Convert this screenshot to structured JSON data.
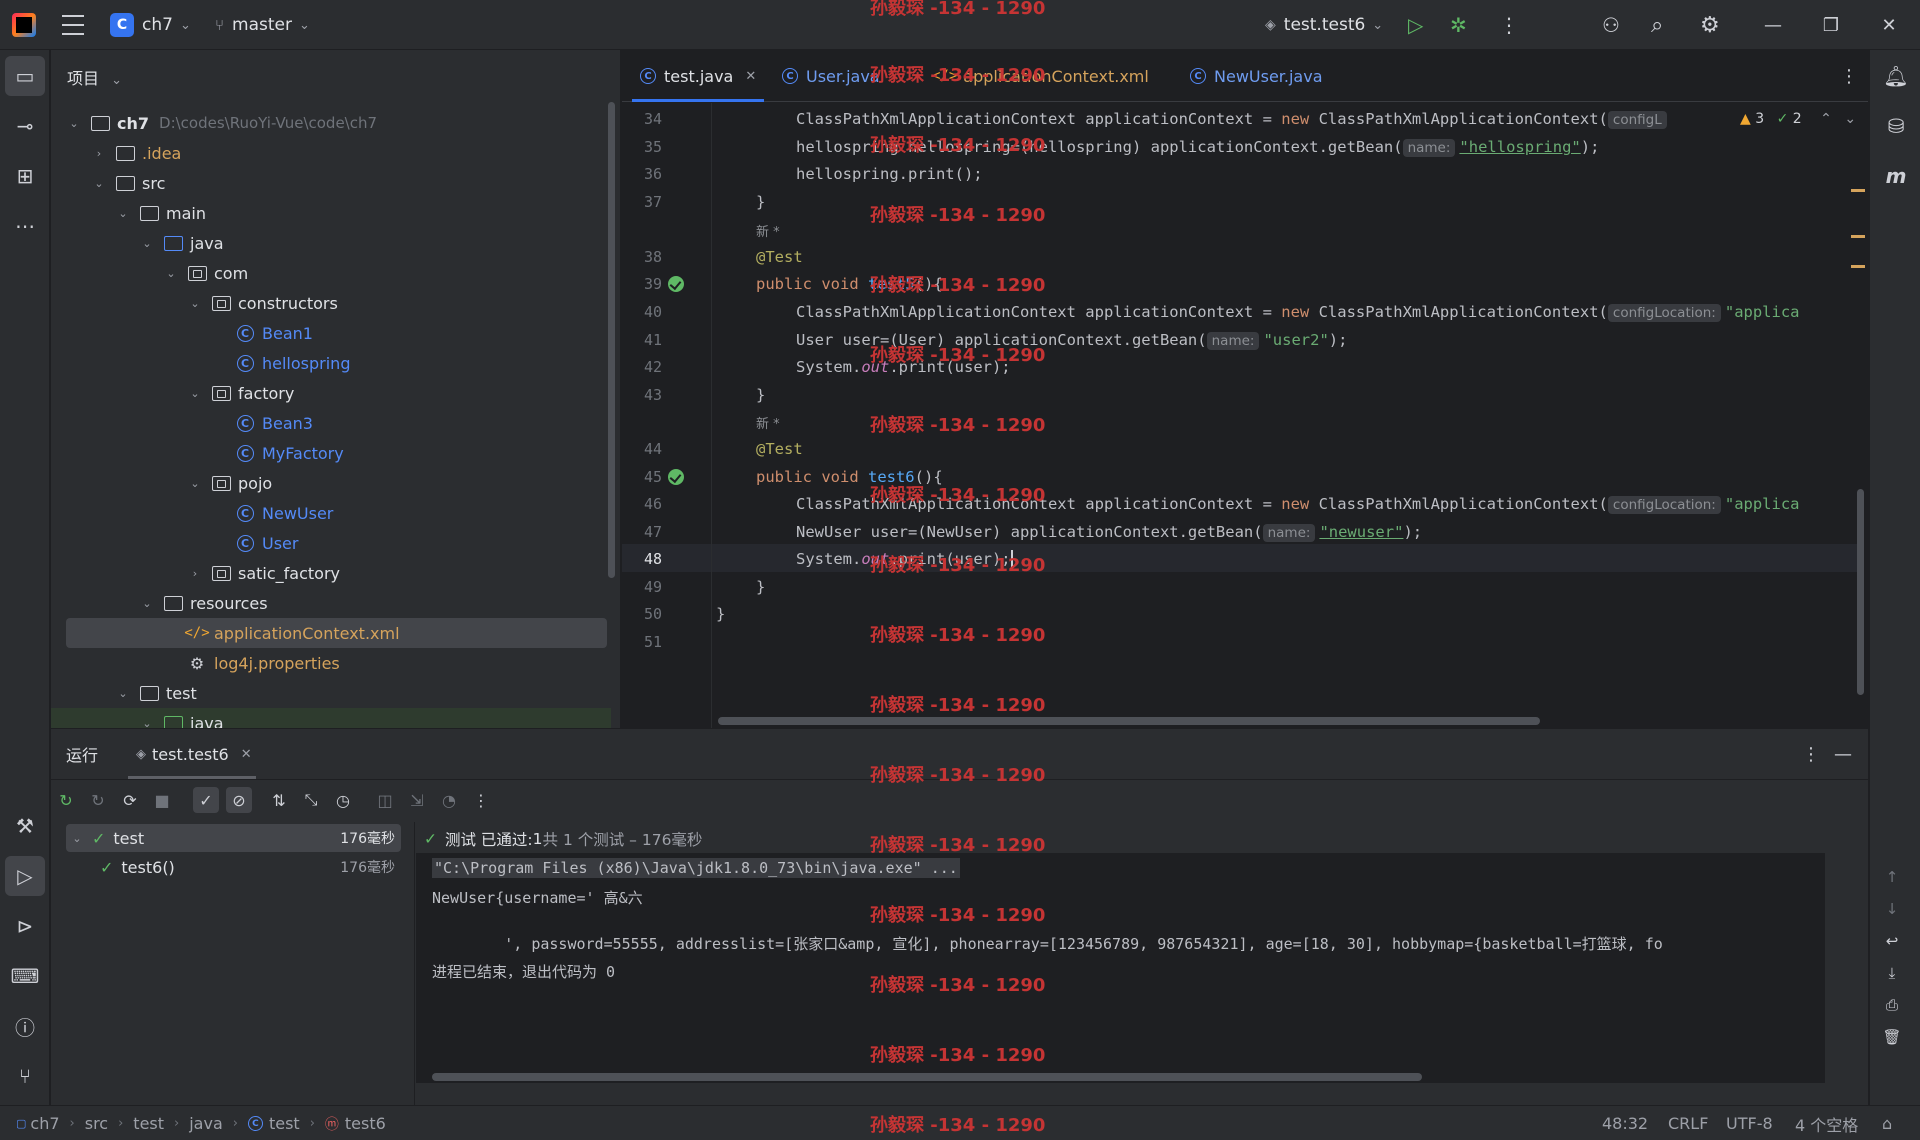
{
  "titlebar": {
    "project_name": "ch7",
    "project_badge": "C",
    "branch": "master",
    "run_config": "test.test6"
  },
  "project_panel": {
    "title": "项目",
    "tree": [
      {
        "label": "ch7",
        "path": "D:\\codes\\RuoYi-Vue\\code\\ch7"
      },
      {
        "label": ".idea"
      },
      {
        "label": "src"
      },
      {
        "label": "main"
      },
      {
        "label": "java"
      },
      {
        "label": "com"
      },
      {
        "label": "constructors"
      },
      {
        "label": "Bean1"
      },
      {
        "label": "hellospring"
      },
      {
        "label": "factory"
      },
      {
        "label": "Bean3"
      },
      {
        "label": "MyFactory"
      },
      {
        "label": "pojo"
      },
      {
        "label": "NewUser"
      },
      {
        "label": "User"
      },
      {
        "label": "satic_factory"
      },
      {
        "label": "resources"
      },
      {
        "label": "applicationContext.xml"
      },
      {
        "label": "log4j.properties"
      },
      {
        "label": "test"
      },
      {
        "label": "java"
      }
    ]
  },
  "editor": {
    "tabs": [
      {
        "label": "test.java"
      },
      {
        "label": "User.java"
      },
      {
        "label": "applicationContext.xml"
      },
      {
        "label": "NewUser.java"
      }
    ],
    "inspections": {
      "warnings": "3",
      "weak_warnings": "2"
    },
    "line_numbers": [
      "34",
      "35",
      "36",
      "37",
      "38",
      "39",
      "40",
      "41",
      "42",
      "43",
      "44",
      "45",
      "46",
      "47",
      "48",
      "49",
      "50",
      "51"
    ],
    "code": {
      "l34_a": "ClassPathXmlApplicationContext applicationContext = ",
      "l34_new": "new",
      "l34_b": " ClassPathXmlApplicationContext(",
      "l34_hint": "configL",
      "l35_a": "hellospring hellospring=(hellospring) applicationContext.getBean(",
      "l35_hint": "name:",
      "l35_str": "\"hellospring\"",
      "l35_end": ");",
      "l36": "hellospring.print();",
      "l37": "}",
      "new_author": "新 *",
      "l38": "@Test",
      "l39_a": "public void ",
      "l39_fn": "test5",
      "l39_b": "(){",
      "l40_a": "ClassPathXmlApplicationContext applicationContext = ",
      "l40_new": "new",
      "l40_b": " ClassPathXmlApplicationContext(",
      "l40_hint": "configLocation:",
      "l40_str": "\"applica",
      "l41_a": "User user=(User) applicationContext.getBean(",
      "l41_hint": "name:",
      "l41_str": "\"user2\"",
      "l41_end": ");",
      "l42_a": "System.",
      "l42_out": "out",
      "l42_b": ".print(user);",
      "l43": "}",
      "l44": "@Test",
      "l45_a": "public void ",
      "l45_fn": "test6",
      "l45_b": "(){",
      "l46_a": "ClassPathXmlApplicationContext applicationContext = ",
      "l46_new": "new",
      "l46_b": " ClassPathXmlApplicationContext(",
      "l46_hint": "configLocation:",
      "l46_str": "\"applica",
      "l47_a": "NewUser user=(NewUser) applicationContext.getBean(",
      "l47_hint": "name:",
      "l47_str": "\"newuser\"",
      "l47_end": ");",
      "l48_a": "System.",
      "l48_out": "out",
      "l48_b": ".print(user);",
      "l49": "}",
      "l50": "}"
    }
  },
  "run_panel": {
    "title": "运行",
    "tab": "test.test6",
    "tests": [
      {
        "name": "test",
        "duration": "176毫秒"
      },
      {
        "name": "test6()",
        "duration": "176毫秒"
      }
    ],
    "status_prefix": "测试 已通过: ",
    "status_count": "1",
    "status_suffix": "共 1 个测试 – 176毫秒",
    "console": [
      "\"C:\\Program Files (x86)\\Java\\jdk1.8.0_73\\bin\\java.exe\" ...",
      "NewUser{username=' 高&六",
      "        ', password=55555, addresslist=[张家口&amp, 宣化], phonearray=[123456789, 987654321], age=[18, 30], hobbymap={basketball=打篮球, fo",
      "进程已结束，退出代码为 0"
    ]
  },
  "statusbar": {
    "breadcrumb": [
      "ch7",
      "src",
      "test",
      "java",
      "test",
      "test6"
    ],
    "position": "48:32",
    "line_ending": "CRLF",
    "encoding": "UTF-8",
    "indent": "4 个空格"
  },
  "watermark": "孙毅琛 -134 - 1290",
  "colors": {
    "accent": "#3574f0",
    "success": "#5fb865",
    "watermark": "#c53434"
  }
}
